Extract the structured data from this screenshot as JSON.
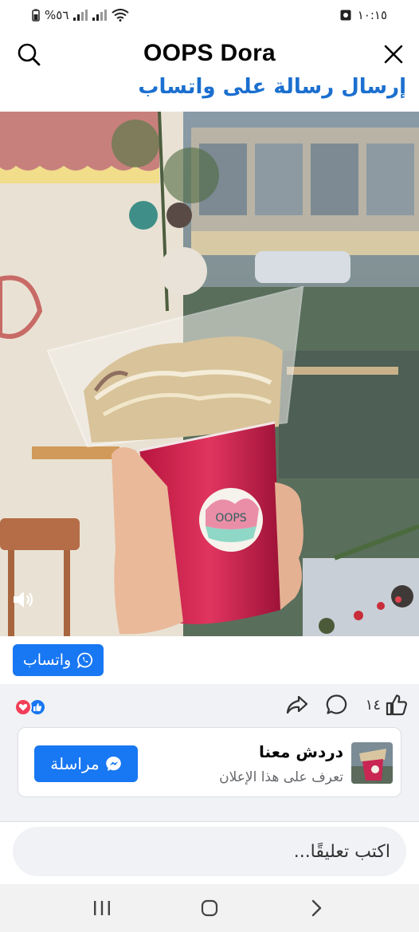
{
  "status_bar": {
    "battery": "%٥٦",
    "time": "١٠:١٥",
    "icons": [
      "battery-icon",
      "signal-icon",
      "signal-icon",
      "wifi-icon",
      "screen-record-icon"
    ]
  },
  "header": {
    "title": "OOPS Dora",
    "subtitle": "إرسال رسالة على واتساب",
    "icons": [
      "search-icon",
      "close-icon"
    ]
  },
  "media": {
    "sticker_text": "OOPS",
    "icons": [
      "volume-icon"
    ]
  },
  "cta": {
    "whatsapp_label": "واتساب",
    "icons": [
      "whatsapp-icon"
    ]
  },
  "engagement": {
    "like_count": "١٤",
    "reactions": [
      "love-reaction-icon",
      "like-reaction-icon"
    ],
    "actions": [
      "like-icon",
      "comment-icon",
      "share-icon"
    ]
  },
  "messenger_card": {
    "title": "دردش معنا",
    "subtitle": "تعرف على هذا الإعلان",
    "button_label": "مراسلة",
    "icons": [
      "messenger-icon"
    ]
  },
  "comment": {
    "placeholder": "اكتب تعليقًا..."
  },
  "nav": {
    "buttons": [
      "recent-apps-icon",
      "home-icon",
      "back-icon"
    ]
  },
  "colors": {
    "accent": "#1877f2",
    "link": "#1b6fcf",
    "love": "#f33e58",
    "drink": "#c41f4f"
  }
}
